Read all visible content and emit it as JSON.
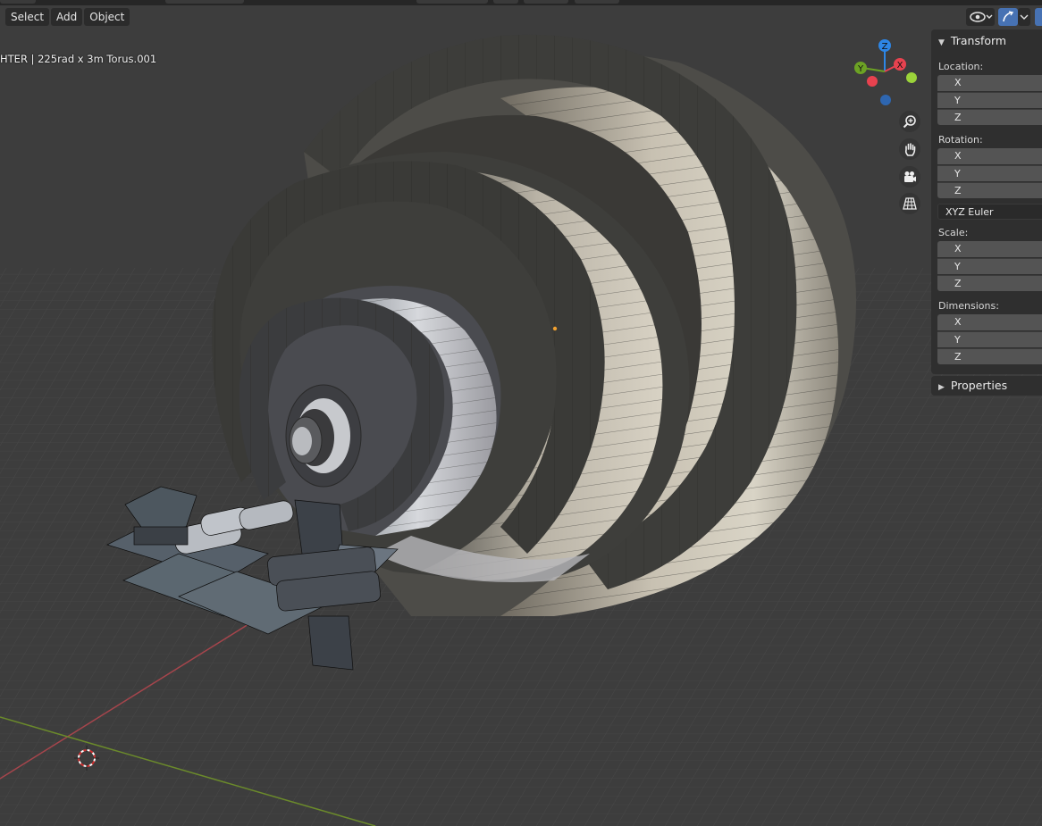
{
  "header": {
    "menu": [
      "Select",
      "Add",
      "Object"
    ]
  },
  "viewport": {
    "overlay_text": "HTER | 225rad x 3m Torus.001"
  },
  "gizmo": {
    "axes": {
      "z": "Z",
      "y": "Y",
      "x": "X"
    },
    "colors": {
      "x": "#e8424f",
      "y": "#6ca224",
      "z": "#2d86e6",
      "neg_x": "#e8424f",
      "neg_y": "#9bd33a",
      "neg_z": "#2e66b0"
    },
    "nav_icons": [
      "zoom-icon",
      "hand-pan-icon",
      "camera-icon",
      "grid-view-icon"
    ]
  },
  "sidebar": {
    "transform_title": "Transform",
    "location_label": "Location:",
    "rotation_label": "Rotation:",
    "scale_label": "Scale:",
    "dimensions_label": "Dimensions:",
    "axis_x": "X",
    "axis_y": "Y",
    "axis_z": "Z",
    "rotation_mode": "XYZ Euler",
    "properties_title": "Properties"
  }
}
